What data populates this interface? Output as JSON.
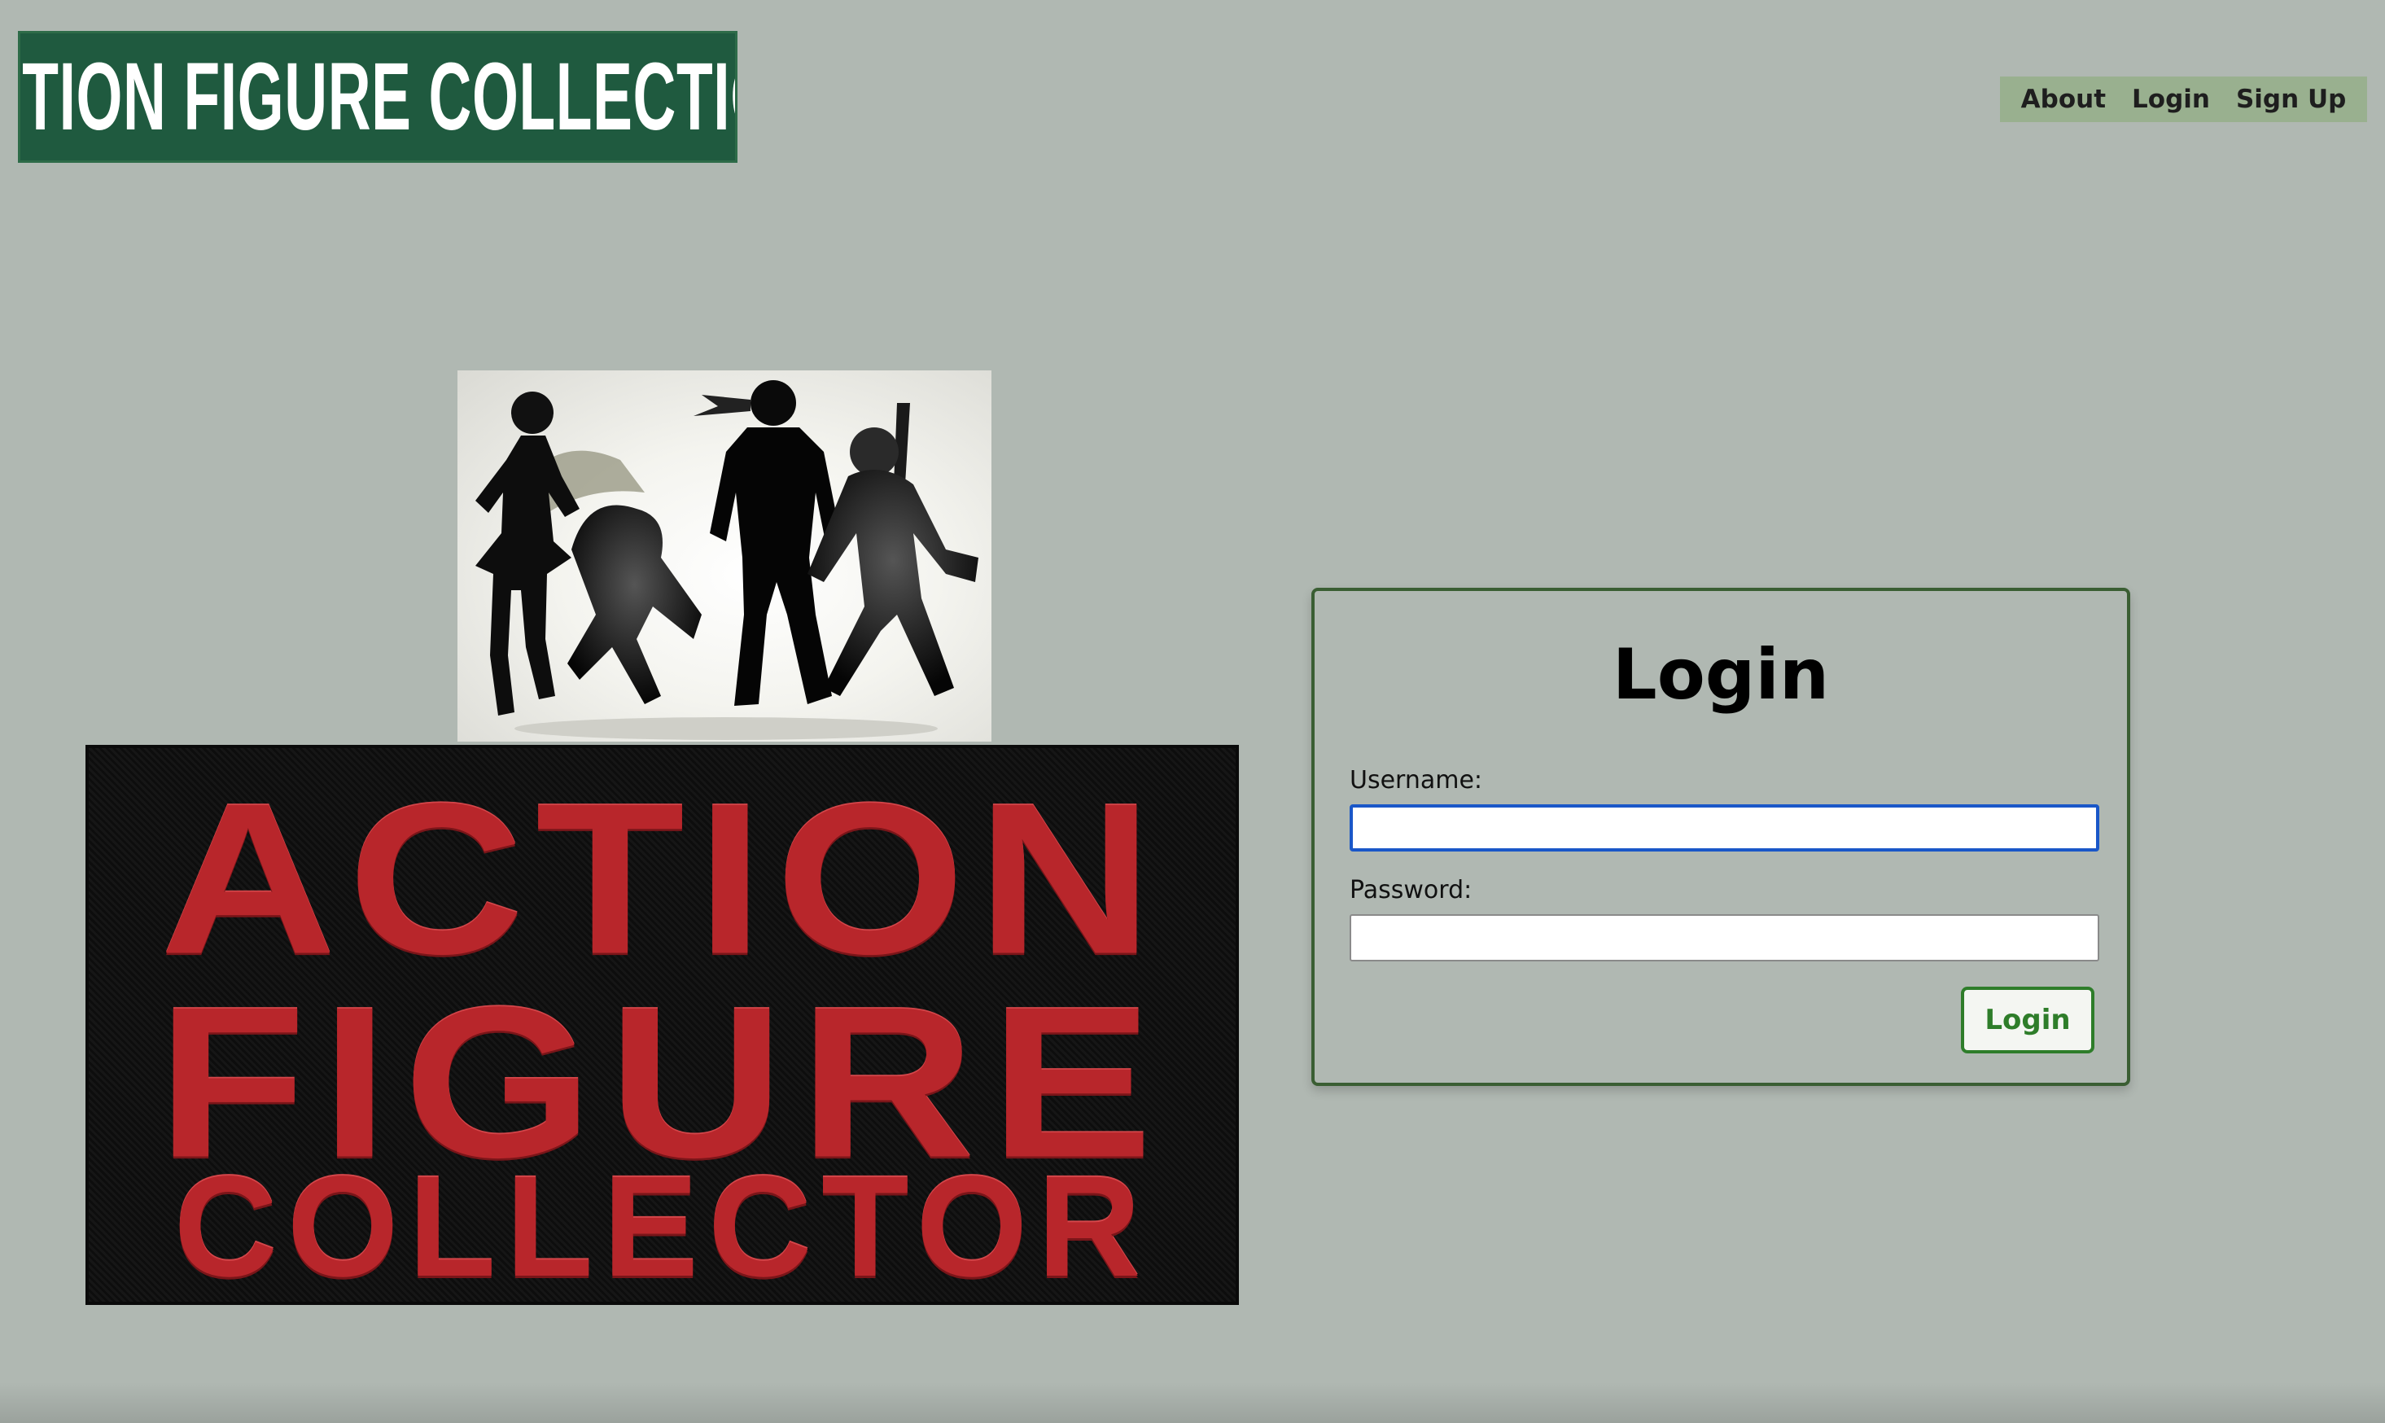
{
  "header": {
    "logo_text": "ACTION FIGURE COLLECTION"
  },
  "nav": {
    "items": [
      {
        "label": "About"
      },
      {
        "label": "Login"
      },
      {
        "label": "Sign Up"
      }
    ]
  },
  "hero": {
    "patch_lines": [
      "ACTION",
      "FIGURE",
      "COLLECTOR"
    ]
  },
  "login": {
    "title": "Login",
    "username_label": "Username:",
    "username_value": "",
    "password_label": "Password:",
    "password_value": "",
    "submit_label": "Login"
  },
  "colors": {
    "page_background": "#b0b8b2",
    "logo_green": "#1f5a3f",
    "nav_background": "#99b08f",
    "patch_red": "#b8262b",
    "card_border": "#3a5e33",
    "button_green": "#2e7d2a",
    "focus_blue": "#1a57c8"
  }
}
